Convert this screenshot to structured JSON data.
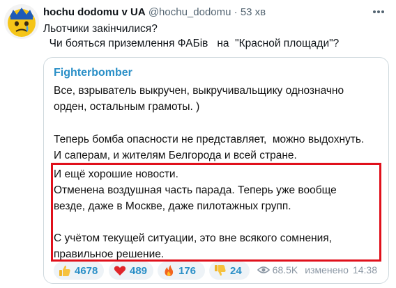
{
  "author": {
    "name": "hochu dodomu v UA",
    "handle": "@hochu_dodomu",
    "separator": "·",
    "time": "53 хв"
  },
  "tweet": {
    "lines": [
      "Льотчики закінчилися?",
      "  Чи бояться приземлення ФАБів   на  \"Красной площади\"?"
    ]
  },
  "quote": {
    "channel": "Fighterbomber",
    "paragraph1": [
      "Все, взрыватель выкручен, выкручивальщику однозначно",
      "орден, остальным грамоты. )"
    ],
    "paragraph2": [
      "Теперь бомба опасности не представляет,  можно выдохнуть.",
      "И саперам, и жителям Белгорода и всей стране."
    ],
    "paragraph3": [
      "И ещё хорошие новости.",
      "Отменена воздушная часть парада. Теперь уже вообще",
      "везде, даже в Москве, даже пилотажных групп."
    ],
    "paragraph4": [
      "С учётом текущей ситуации, это вне всякого сомнения,",
      "правильное решение."
    ],
    "reactions": [
      {
        "icon": "thumbs-up-icon",
        "count": "4678"
      },
      {
        "icon": "heart-icon",
        "count": "489"
      },
      {
        "icon": "fire-icon",
        "count": "176"
      },
      {
        "icon": "thumbs-down-icon",
        "count": "24"
      }
    ],
    "views": "68.5K",
    "edited": "изменено",
    "time": "14:38"
  },
  "colors": {
    "highlight_border": "#e0101b",
    "channel_name": "#2a8fc7",
    "reaction_bg": "#eef3f7"
  }
}
